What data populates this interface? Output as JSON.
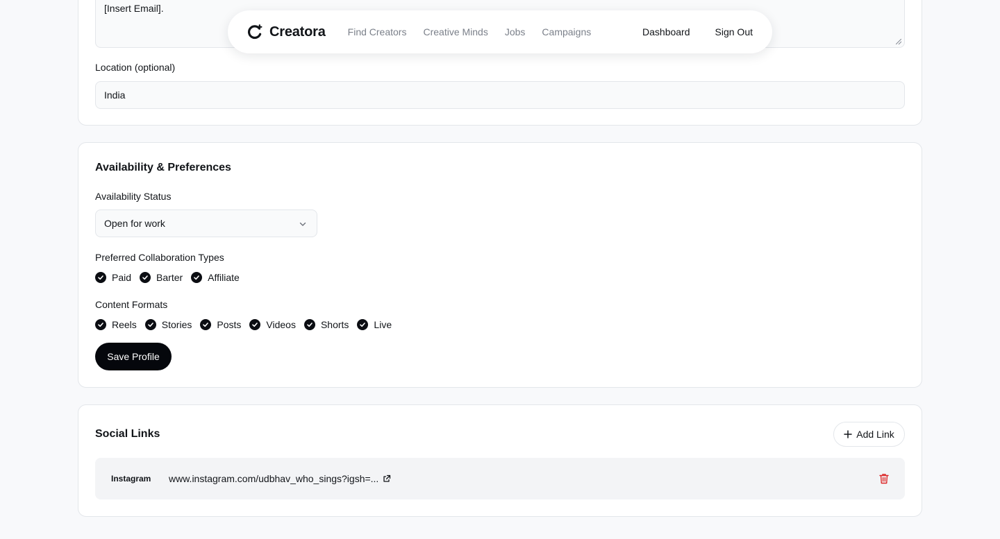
{
  "navbar": {
    "brand": "Creatora",
    "links": [
      "Find Creators",
      "Creative Minds",
      "Jobs",
      "Campaigns"
    ],
    "dashboard": "Dashboard",
    "sign_out": "Sign Out"
  },
  "contact": {
    "textarea_value": "[Insert Email].",
    "location_label": "Location (optional)",
    "location_value": "India"
  },
  "availability": {
    "title": "Availability & Preferences",
    "status_label": "Availability Status",
    "status_value": "Open for work",
    "collab_label": "Preferred Collaboration Types",
    "collab_types": [
      "Paid",
      "Barter",
      "Affiliate"
    ],
    "formats_label": "Content Formats",
    "formats": [
      "Reels",
      "Stories",
      "Posts",
      "Videos",
      "Shorts",
      "Live"
    ],
    "save_label": "Save Profile"
  },
  "social": {
    "title": "Social Links",
    "add_label": "Add Link",
    "links": [
      {
        "platform": "Instagram",
        "url": "www.instagram.com/udbhav_who_sings?igsh=..."
      }
    ]
  },
  "colors": {
    "primary": "#05070c",
    "muted_text": "#7b808a",
    "danger": "#dc2626",
    "border": "#e3e6ea"
  },
  "icons": [
    "logo-icon",
    "chevron-down-icon",
    "check-circle-icon",
    "plus-icon",
    "external-link-icon",
    "trash-icon"
  ]
}
